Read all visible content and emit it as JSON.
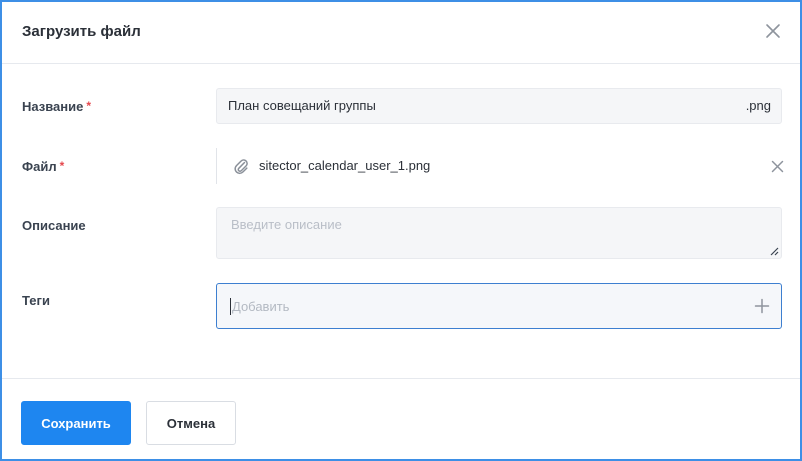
{
  "dialog": {
    "title": "Загрузить файл",
    "close_icon": "close-icon"
  },
  "form": {
    "name": {
      "label": "Название",
      "required_mark": "*",
      "value": "План совещаний группы",
      "extension": ".png"
    },
    "file": {
      "label": "Файл",
      "required_mark": "*",
      "icon": "paperclip-icon",
      "filename": "sitector_calendar_user_1.png",
      "remove_icon": "close-icon"
    },
    "description": {
      "label": "Описание",
      "placeholder": "Введите описание",
      "value": ""
    },
    "tags": {
      "label": "Теги",
      "placeholder": "Добавить",
      "add_icon": "plus-icon"
    }
  },
  "footer": {
    "save_label": "Сохранить",
    "cancel_label": "Отмена"
  },
  "colors": {
    "accent": "#1e86f0",
    "dialog_border": "#3d8fe6",
    "required": "#e5484d",
    "input_bg": "#f5f6f8"
  }
}
